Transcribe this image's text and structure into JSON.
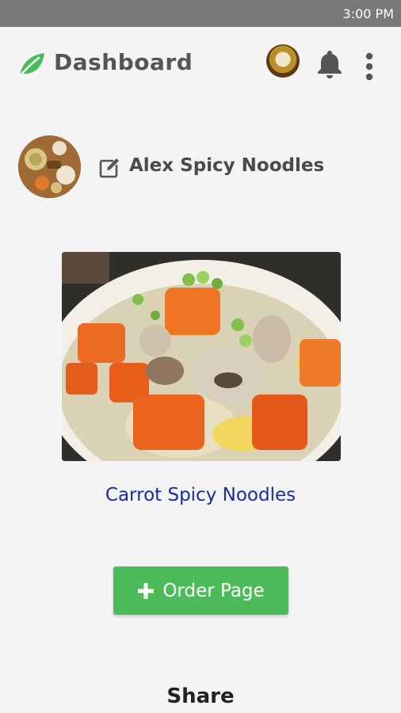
{
  "status_bar": {
    "time": "3:00 PM"
  },
  "app_bar": {
    "title": "Dashboard",
    "icons": [
      "leaf-icon",
      "notification-bell-icon",
      "more-vert-icon"
    ],
    "brand_color": "#4dbb5a"
  },
  "profile": {
    "name": "Alex Spicy Noodles",
    "edit_icon": "edit-icon"
  },
  "dish": {
    "caption": "Carrot Spicy Noodles",
    "caption_color": "#1b2aa0"
  },
  "actions": {
    "order_label": "Order Page",
    "order_icon": "plus-icon",
    "order_color": "#4dbb5a"
  },
  "footer": {
    "share_title": "Share"
  }
}
